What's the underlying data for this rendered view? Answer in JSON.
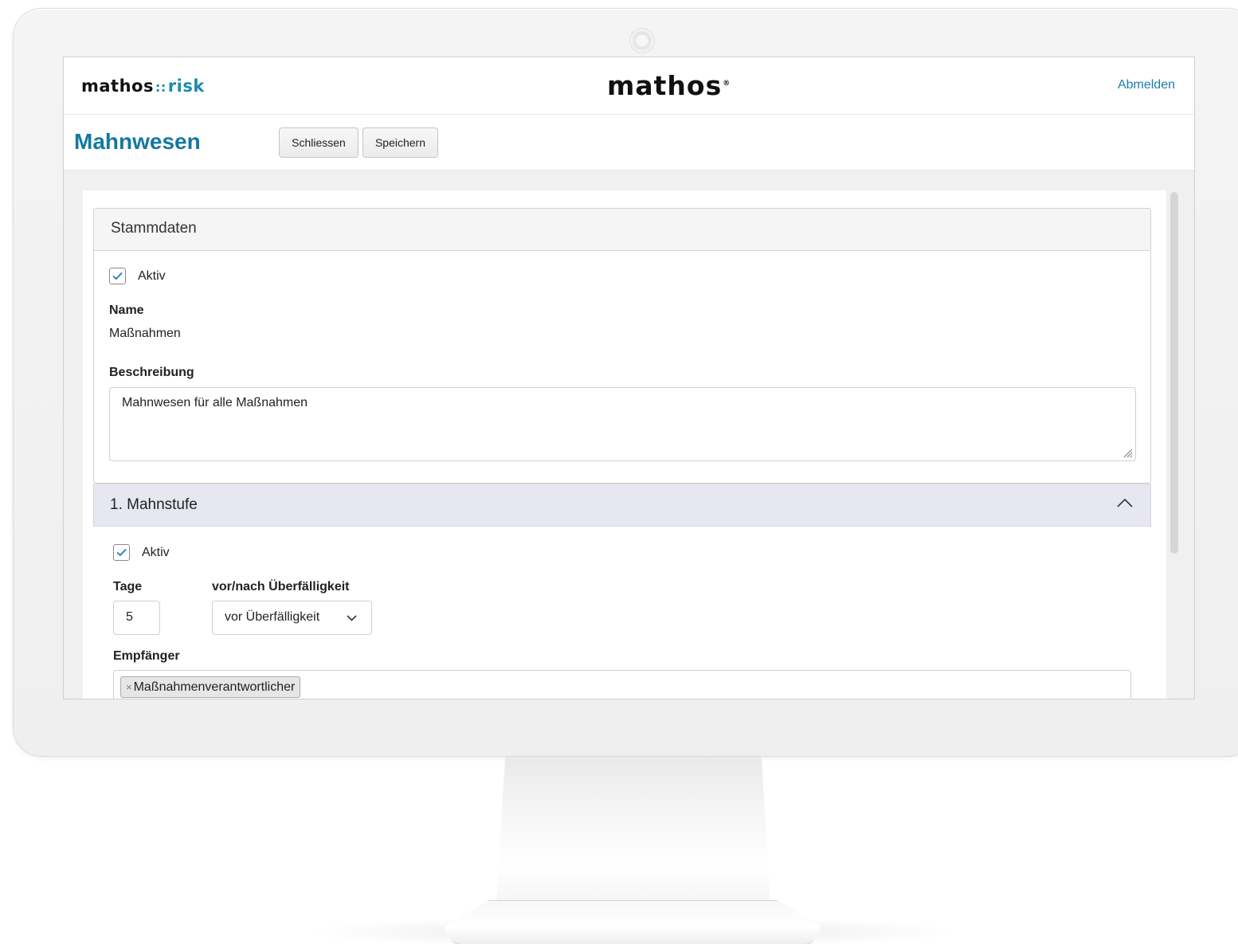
{
  "app": {
    "logo_left_main": "mathos",
    "logo_left_sep": "::",
    "logo_left_accent": "risk",
    "logo_center": "mathos",
    "logo_center_mark": "®",
    "logout_label": "Abmelden",
    "page_title": "Mahnwesen"
  },
  "toolbar": {
    "close_label": "Schliessen",
    "save_label": "Speichern"
  },
  "stammdaten": {
    "title": "Stammdaten",
    "active_label": "Aktiv",
    "active_checked": true,
    "name_label": "Name",
    "name_value": "Maßnahmen",
    "description_label": "Beschreibung",
    "description_value": "Mahnwesen für alle Maßnahmen"
  },
  "level1": {
    "title": "1. Mahnstufe",
    "expanded": true,
    "active_label": "Aktiv",
    "active_checked": true,
    "days_label": "Tage",
    "days_value": "5",
    "timing_label": "vor/nach Überfälligkeit",
    "timing_value": "vor Überfälligkeit",
    "recipients_label": "Empfänger",
    "recipients": [
      "Maßnahmenverantwortlicher"
    ],
    "tag_remove_glyph": "×"
  },
  "colors": {
    "brand": "#1478a0",
    "accent": "#1a8bb0",
    "accordion_header": "#e6e7f1"
  }
}
